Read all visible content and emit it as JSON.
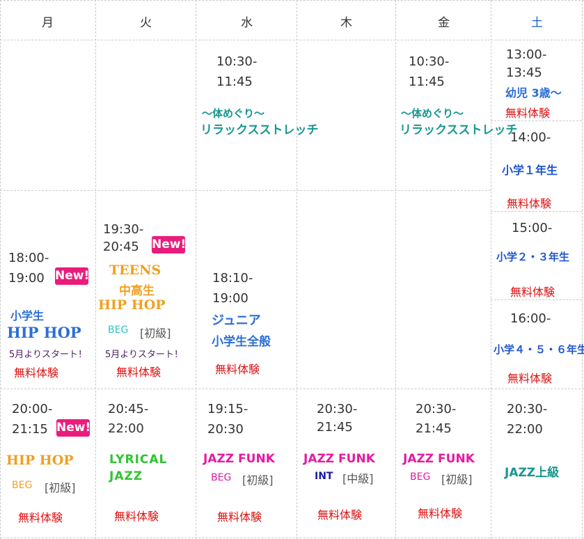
{
  "days": [
    "月",
    "火",
    "水",
    "木",
    "金",
    "土"
  ],
  "badge": "New!",
  "free_trial": "無料体験",
  "start_may": "5月よりスタート！",
  "beg": "BEG",
  "beg_label": "[初級]",
  "int": "INT",
  "int_label": "[中級]",
  "row1": {
    "wed": {
      "time1": "10:30-",
      "time2": "11:45",
      "name1": "～体めぐり～",
      "name2": "リラックスストレッチ"
    },
    "fri": {
      "time1": "10:30-",
      "time2": "11:45",
      "name1": "～体めぐり～",
      "name2": "リラックスストレッチ"
    },
    "sat_a": {
      "time1": "13:00-",
      "time2": "13:45",
      "name": "幼児 3歳～"
    },
    "sat_b": {
      "time": "14:00-",
      "name": "小学１年生"
    }
  },
  "row2": {
    "mon": {
      "time1": "18:00-",
      "time2": "19:00",
      "name1": "小学生",
      "name2": "HIP HOP"
    },
    "tue": {
      "time1": "19:30-",
      "time2": "20:45",
      "name1": "TEENS",
      "name2": "中高生",
      "name3": "HIP HOP"
    },
    "wed": {
      "time1": "18:10-",
      "time2": "19:00",
      "name1": "ジュニア",
      "name2": "小学生全般"
    },
    "sat_c": {
      "time": "15:00-",
      "name": "小学２・３年生"
    },
    "sat_d": {
      "time": "16:00-",
      "name": "小学４・５・６年生"
    }
  },
  "row3": {
    "mon": {
      "time1": "20:00-",
      "time2": "21:15",
      "name": "HIP HOP"
    },
    "tue": {
      "time1": "20:45-",
      "time2": "22:00",
      "name1": "LYRICAL",
      "name2": "JAZZ"
    },
    "wed": {
      "time1": "19:15-",
      "time2": "20:30",
      "name": "JAZZ FUNK"
    },
    "thu": {
      "time1": "20:30-",
      "time2": "21:45",
      "name": "JAZZ FUNK"
    },
    "fri": {
      "time1": "20:30-",
      "time2": "21:45",
      "name": "JAZZ FUNK"
    },
    "sat": {
      "time1": "20:30-",
      "time2": "22:00",
      "name": "JAZZ上級"
    }
  },
  "colors": {
    "free": "#e01010",
    "badge": "#ea1c7b",
    "saturday": "#1b5fc6"
  }
}
